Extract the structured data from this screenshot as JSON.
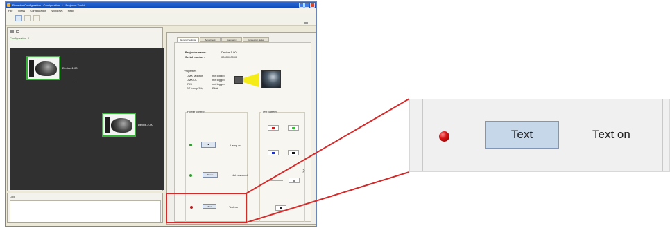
{
  "window": {
    "title": "Projector Configuration - Configuration -1 - Projector Toolkit",
    "menu": [
      "File",
      "Views",
      "Configuration",
      "Windows",
      "Help"
    ]
  },
  "left_panel": {
    "config_label": "Configuration -1",
    "nodes": [
      {
        "label": "Device-1-00"
      },
      {
        "label": "Device-2-00"
      }
    ]
  },
  "log_panel": {
    "label": "Log"
  },
  "right_panel": {
    "tabs": [
      "General Settings",
      "Adjustment",
      "Geometry",
      "Connection Setup"
    ],
    "projector_name_label": "Projector name:",
    "projector_name_value": "Device-1-00",
    "serial_number_label": "Serial number:",
    "serial_number_value": "0000000000",
    "properties_title": "Properties",
    "properties": [
      {
        "label": "DMX Monitor",
        "value": "not logged"
      },
      {
        "label": "DMX/DL",
        "value": "not logged"
      },
      {
        "label": "IRIS",
        "value": "not logged"
      },
      {
        "label": "DT Lamp/Obj",
        "value": "Blink"
      }
    ],
    "power_control_title": "Power control",
    "lamp_on_label": "Lamp on",
    "power_button_label": "Power",
    "not_powered_label": "Not powered",
    "test_button_label": "Text",
    "text_on_label": "Text on",
    "test_pattern_title": "Test pattern"
  },
  "zoom": {
    "button_label": "Text",
    "status_label": "Text on",
    "indicator_color": "#d61414"
  },
  "colors": {
    "callout_line": "#d42a2a",
    "node_border": "#36b336",
    "canvas": "#303030",
    "power_on": "#2e9c2e",
    "power_off": "#b02020"
  },
  "icons": [
    "app-icon",
    "minimize-icon",
    "maximize-icon",
    "close-icon",
    "select-tool-icon",
    "move-tool-icon",
    "fit-view-icon",
    "projector-icon",
    "light-beam-icon",
    "preview-image-icon"
  ]
}
